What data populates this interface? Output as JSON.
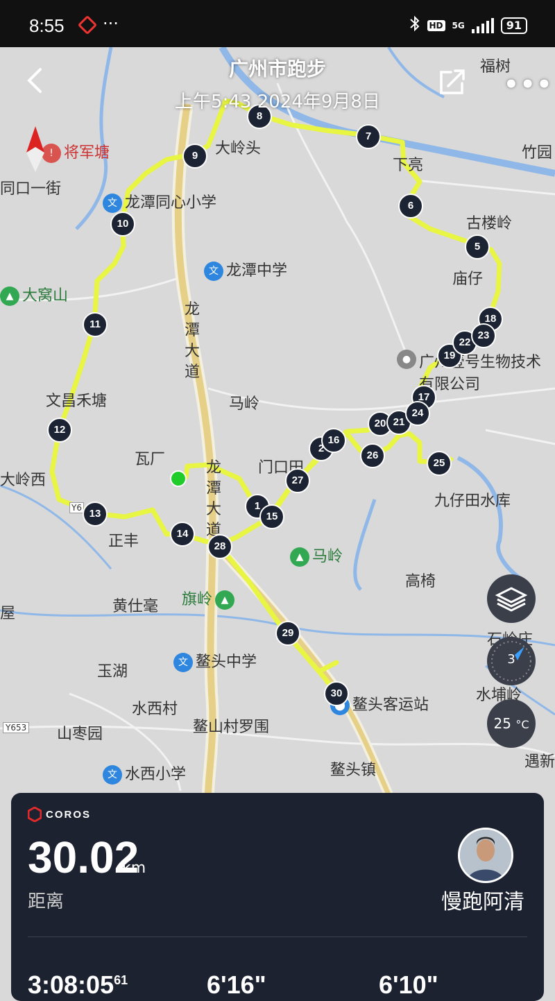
{
  "status_bar": {
    "time": "8:55",
    "more": "···",
    "hd": "HD",
    "network": "5G",
    "battery": "91"
  },
  "header": {
    "title": "广州市跑步",
    "subtitle": "上午5:43 2024年9月8日",
    "more": "•••"
  },
  "map": {
    "labels": {
      "jiangjuntang": "将军塘",
      "tongkou": "同口一街",
      "fushu": "福树",
      "zhuyuan": "竹园",
      "dalingtou": "大岭头",
      "xialiang": "下亮",
      "gulouling": "古楼岭",
      "miaozai": "庙仔",
      "longtan_tongxin": "龙潭同心小学",
      "longtan_zhongxue": "龙潭中学",
      "dawoshan": "大窝山",
      "longtan_dadao_1": "龙潭大道",
      "longtan_dadao_2": "龙潭大道",
      "company": "广州壹号生物技术有限公司",
      "wenchang": "文昌禾塘",
      "maling_village": "马岭",
      "waichang": "瓦厂",
      "menkoutian": "门口田",
      "dalingxi": "大岭西",
      "jiuzaitian": "九仔田水库",
      "zhengfeng": "正丰",
      "maling_mountain": "马岭",
      "gaoyi": "高椅",
      "huangshihao": "黄仕毫",
      "qiling": "旗岭",
      "wu": "屋",
      "shilingzhuang": "石岭庄",
      "yuhu": "玉湖",
      "aotou_zhongxue": "鳌头中学",
      "aotou_keyunzhan": "鳌头客运站",
      "shuibuling": "水埔岭",
      "shuixicun": "水西村",
      "shanzaoyuan": "山枣园",
      "aoshan": "鳌山村罗围",
      "yuxin": "遇新",
      "shuixi_xiaoxue": "水西小学",
      "aotouzhen": "鳌头镇",
      "road_y653": "Y653",
      "road_y6": "Y6"
    },
    "poi_glyph": "文",
    "markers": [
      "1",
      "2",
      "5",
      "6",
      "7",
      "8",
      "9",
      "10",
      "11",
      "12",
      "13",
      "14",
      "15",
      "16",
      "17",
      "18",
      "19",
      "20",
      "21",
      "22",
      "23",
      "24",
      "25",
      "26",
      "27",
      "28",
      "29",
      "30"
    ],
    "route_color": "#e8f542",
    "compass_value": "3",
    "temperature": "25",
    "temperature_unit": "°C"
  },
  "summary": {
    "brand": "COROS",
    "distance": "30.02",
    "distance_unit": "km",
    "distance_label": "距离",
    "username": "慢跑阿清",
    "stat_time": "3:08:05",
    "stat_time_fraction": "61",
    "stat_pace": "6'16\"",
    "stat_pace2": "6'10\""
  }
}
